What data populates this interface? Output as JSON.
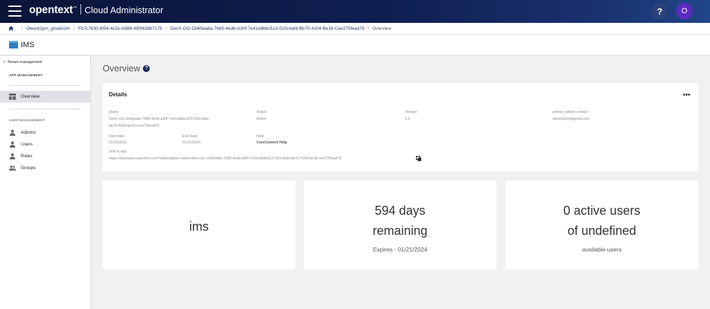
{
  "header": {
    "brand": "opentext",
    "trademark": "™",
    "app_name": "Cloud Administrator",
    "help_label": "?",
    "avatar_initial": "O"
  },
  "breadcrumb": {
    "items": [
      "Otexot2pm_gmailcom",
      "Fb7c7630-8f54-4c2e-Ab88-490f438b7178",
      "DevX-Ot2-Cb65ea8a-7685-4edb-A30f-7e41e8bbc513-010c4afd-Bb70-4104-Be18-Cee275fead79"
    ],
    "current": "Overview"
  },
  "page": {
    "title": "IMS"
  },
  "sidebar": {
    "back_label": "Tenant management",
    "app_section": "APP MANAGEMENT",
    "overview_label": "Overview",
    "user_section": "USER MANAGEMENT",
    "items": [
      {
        "label": "Admins",
        "icon": "admin-icon"
      },
      {
        "label": "Users",
        "icon": "user-icon"
      },
      {
        "label": "Roles",
        "icon": "role-icon"
      },
      {
        "label": "Groups",
        "icon": "group-icon"
      }
    ]
  },
  "main": {
    "heading": "Overview",
    "details": {
      "title": "Details",
      "more_label": "•••",
      "name_label": "Name",
      "name_lines": [
        "DevX-ot2-cb65ea8a-7685-4edb-a30f-7e41e8bbc513-010c4afd-",
        "bb70-4104-be18-cee275fead79"
      ],
      "status_label": "Status",
      "status_value": "Active",
      "version_label": "Version",
      "version_value": "1.0",
      "contact_label": "primary admin contact",
      "contact_value": "otexot2pm@gmail.com",
      "start_label": "Start date",
      "start_value": "01/20/2022",
      "end_label": "End Date",
      "end_value": "01/21/2024",
      "help_label": "Help",
      "help_value": "CoreContent Help",
      "link_label": "Link to app",
      "link_value": "https://developer.opentext.com?subscription-name=devx-ot2-cb65ea8a-7685-4edb-a30f-7e41e8bbc513-010c4afd-bb70-4104-be18-cee275fead79"
    },
    "cards": {
      "app_name": "ims",
      "days_line1": "594 days",
      "days_line2": "remaining",
      "expires": "Expires - 01/21/2024",
      "users_line1": "0 active users",
      "users_line2": "of undefined",
      "users_sub": "available users"
    }
  },
  "colors": {
    "header_dark": "#0b1538",
    "header_light": "#214688",
    "avatar": "#5b2bc0",
    "active_nav": "#dfe1e6"
  }
}
